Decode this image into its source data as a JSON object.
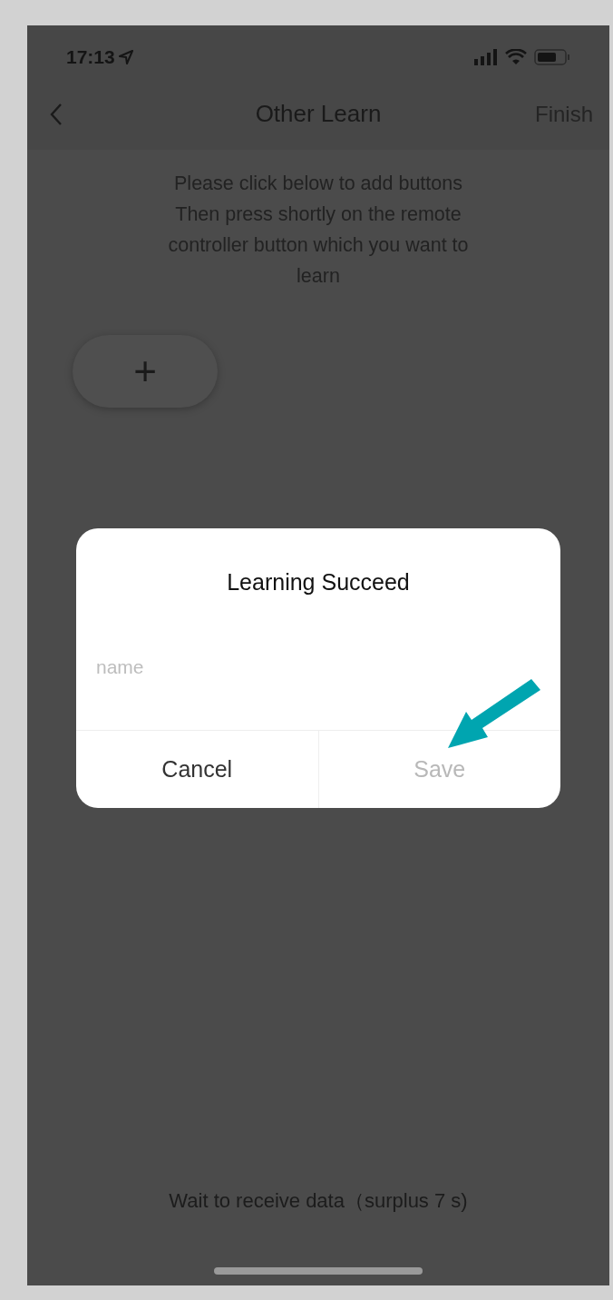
{
  "status_bar": {
    "time": "17:13"
  },
  "nav": {
    "title": "Other Learn",
    "action": "Finish"
  },
  "instructions": [
    "Please click below to add buttons",
    "Then press shortly on the remote",
    "controller button which you want to",
    "learn"
  ],
  "add_button": {
    "label": "+"
  },
  "dialog": {
    "title": "Learning Succeed",
    "field": {
      "placeholder": "name"
    },
    "buttons": [
      {
        "label": "Cancel",
        "disabled": false
      },
      {
        "label": "Save",
        "disabled": true
      }
    ]
  },
  "footer": {
    "text": "Wait to receive data（surplus 7 s)"
  }
}
